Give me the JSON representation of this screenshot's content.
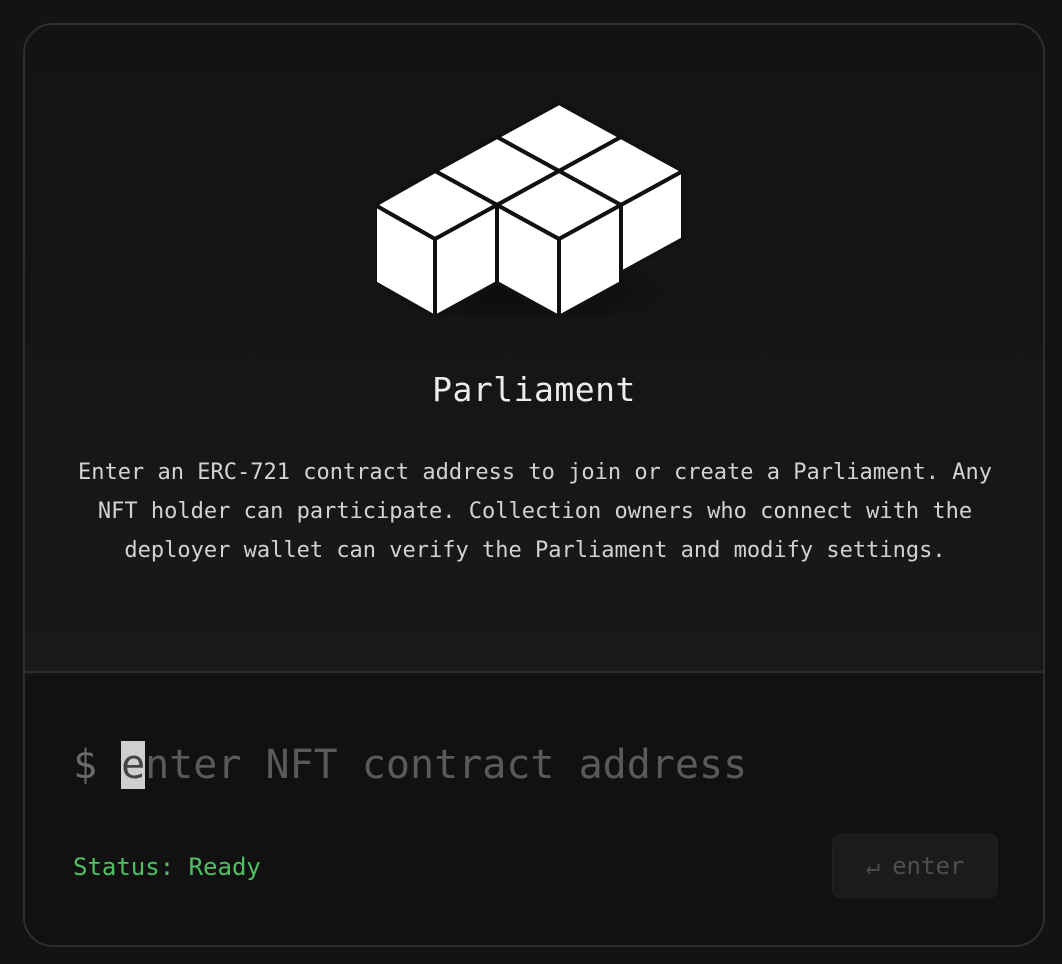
{
  "header": {
    "title": "Parliament",
    "description": "Enter an ERC-721 contract address to join or create a Parliament. Any NFT holder can participate. Collection owners who connect with the deployer wallet can verify the Parliament and modify settings.",
    "logo_icon": "cubes-logo-icon"
  },
  "input": {
    "prompt": "$",
    "cursor_char": "e",
    "placeholder_rest": "nter NFT contract address",
    "placeholder": "enter NFT contract address"
  },
  "status": {
    "text": "Status: Ready",
    "color": "#4fc163"
  },
  "submit": {
    "icon": "↵",
    "label": "enter"
  }
}
